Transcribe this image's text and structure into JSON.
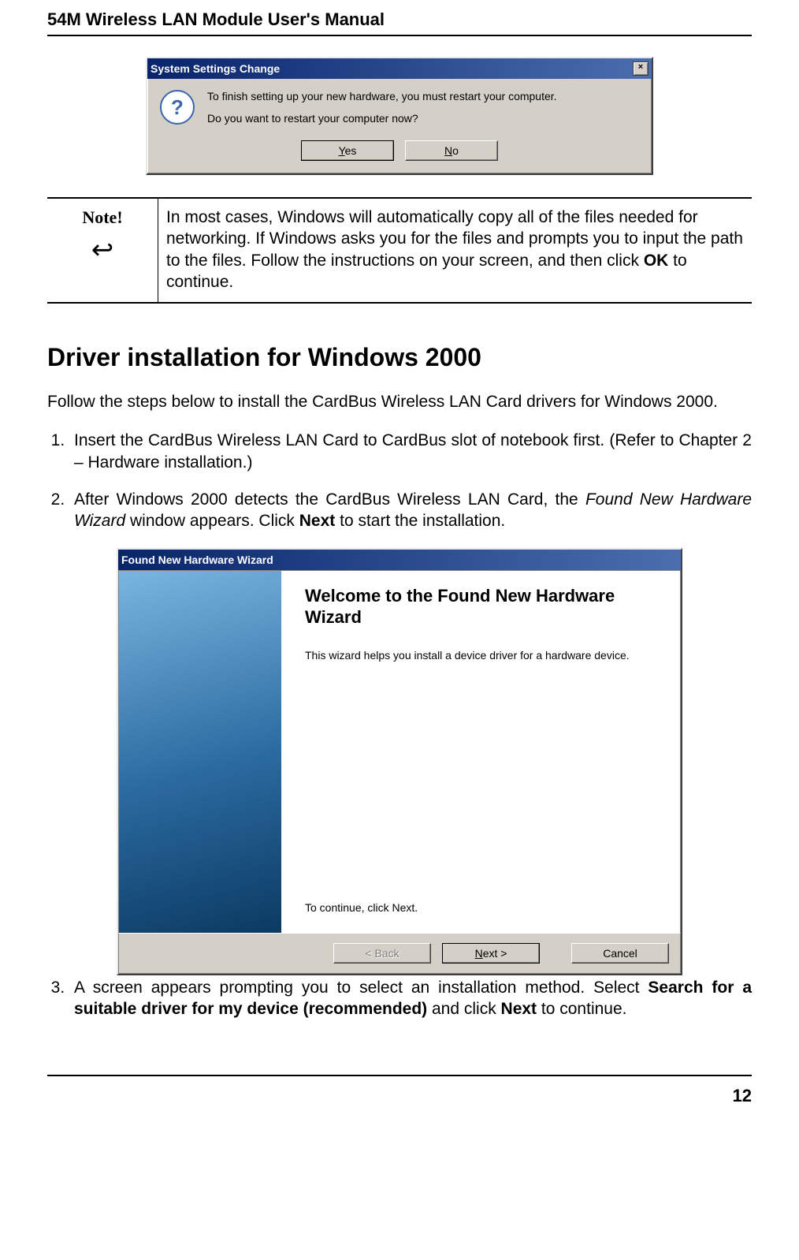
{
  "page": {
    "running_head": "54M Wireless LAN Module User's Manual",
    "page_number": "12"
  },
  "dialog1": {
    "title": "System Settings Change",
    "close_label": "×",
    "question_mark": "?",
    "line1": "To finish setting up your new hardware, you must restart your computer.",
    "line2": "Do you want to restart your computer now?",
    "yes_prefix": "",
    "yes_ul": "Y",
    "yes_suffix": "es",
    "no_prefix": "",
    "no_ul": "N",
    "no_suffix": "o"
  },
  "note": {
    "label": "Note!",
    "icon": "↩",
    "text_pre": "In most cases, Windows will automatically copy all of the files needed for networking. If Windows asks you for the files and prompts you to input the path to the files. Follow the instructions on your screen, and then click ",
    "ok": "OK",
    "text_post": " to continue."
  },
  "section": {
    "heading": "Driver installation for Windows 2000",
    "intro": "Follow the steps below to install the CardBus Wireless LAN Card drivers for Windows 2000.",
    "step1": "Insert the CardBus Wireless LAN Card to CardBus slot of notebook first. (Refer to Chapter 2 – Hardware installation.)",
    "step2_pre": "After Windows 2000 detects the CardBus Wireless LAN Card, the ",
    "step2_em": "Found New Hardware Wizard",
    "step2_mid": " window appears. Click ",
    "step2_b1": "Next",
    "step2_post": " to start the installation.",
    "step3_pre": "A screen appears prompting you to select an installation method. Select ",
    "step3_b1": "Search for a suitable driver for my device (recommended)",
    "step3_mid": " and click ",
    "step3_b2": "Next",
    "step3_post": " to continue."
  },
  "dialog2": {
    "title": "Found New Hardware Wizard",
    "heading": "Welcome to the Found New Hardware Wizard",
    "body1": "This wizard helps you install a device driver for a hardware device.",
    "body2": "To continue, click Next.",
    "back_label": "< Back",
    "next_prefix": "",
    "next_ul": "N",
    "next_suffix": "ext >",
    "cancel_label": "Cancel"
  }
}
